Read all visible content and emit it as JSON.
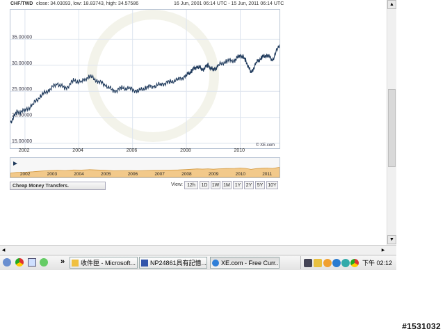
{
  "chart_header": {
    "pair": "CHF/TWD",
    "stats": "close: 34.03093, low: 18.83743, high: 34.57586",
    "range": "16 Jun, 2001 06:14 UTC - 15 Jun, 2011 06:14 UTC"
  },
  "chart_data": {
    "type": "line",
    "title": "CHF/TWD",
    "x_tick_labels": [
      "2002",
      "2004",
      "2006",
      "2008",
      "2010"
    ],
    "y_tick_labels": [
      "15.00000",
      "20.00000",
      "25.00000",
      "30.00000",
      "35.00000"
    ],
    "ylim": [
      15,
      40
    ],
    "xlim": [
      2001.46,
      2011.46
    ],
    "grid": true,
    "source_label": "© XE.com",
    "series": [
      {
        "x": [
          2001.46,
          2001.7,
          2002.0,
          2002.3,
          2002.6,
          2002.9,
          2003.2,
          2003.5,
          2003.8,
          2004.1,
          2004.4,
          2004.7,
          2005.0,
          2005.3,
          2005.6,
          2005.9,
          2006.2,
          2006.5,
          2006.8,
          2007.1,
          2007.4,
          2007.7,
          2008.0,
          2008.2,
          2008.4,
          2008.6,
          2008.8,
          2009.0,
          2009.2,
          2009.5,
          2009.8,
          2010.0,
          2010.2,
          2010.4,
          2010.6,
          2010.8,
          2011.0,
          2011.2,
          2011.46
        ],
        "y": [
          19.0,
          21.0,
          21.2,
          22.5,
          24.2,
          25.3,
          26.5,
          25.5,
          27.0,
          26.8,
          27.9,
          27.0,
          26.2,
          25.0,
          25.6,
          25.5,
          25.0,
          25.8,
          26.0,
          26.4,
          26.8,
          27.2,
          28.0,
          29.0,
          29.8,
          29.2,
          30.0,
          29.0,
          30.0,
          30.8,
          31.0,
          32.0,
          31.0,
          28.5,
          30.5,
          31.5,
          32.0,
          31.0,
          34.0
        ]
      }
    ]
  },
  "mini_chart": {
    "x_labels": [
      "2002",
      "2003",
      "2004",
      "2005",
      "2006",
      "2007",
      "2008",
      "2009",
      "2010",
      "2011"
    ]
  },
  "controls": {
    "cheap_money": "Cheap Money Transfers.",
    "view_label": "View:",
    "view_buttons": [
      "12h",
      "1D",
      "1W",
      "1M",
      "1Y",
      "2Y",
      "5Y",
      "10Y"
    ]
  },
  "taskbar": {
    "quick_launch_icons": [
      "desktop-icon",
      "chrome-icon",
      "paint-icon",
      "network-icon"
    ],
    "chevron": "»",
    "buttons": [
      {
        "label": "收件匣 - Microsoft..."
      },
      {
        "label": "NP24861具有記憶..."
      },
      {
        "label": "XE.com - Free Curr..."
      }
    ],
    "clock": "下午 02:12"
  },
  "watermark": "#1531032",
  "colors": {
    "line": "#1f3a5c",
    "mini_fill": "#f2c98a",
    "grid": "#dde4ee"
  }
}
